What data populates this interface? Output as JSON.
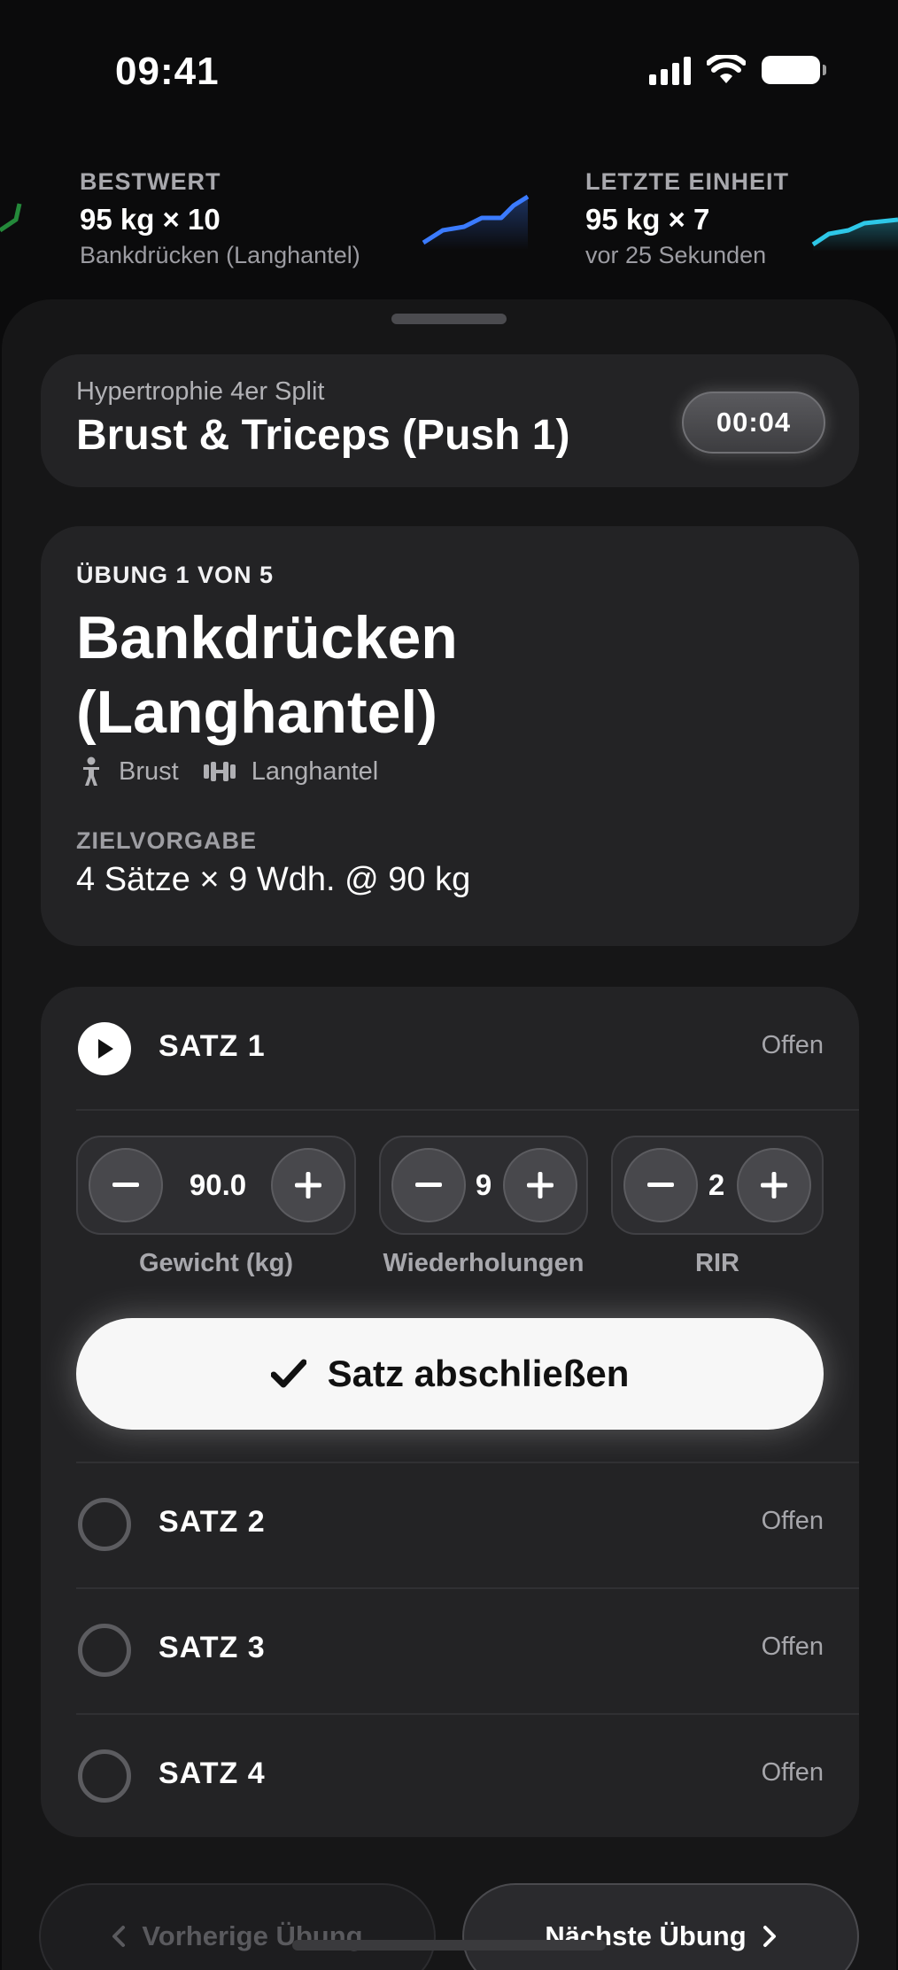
{
  "status_bar": {
    "time": "09:41"
  },
  "widgets": [
    {
      "label": "BESTWERT",
      "value": "95 kg × 10",
      "sub": "Bankdrücken (Langhantel)",
      "color": "#3b7bff"
    },
    {
      "label": "LETZTE EINHEIT",
      "value": "95 kg × 7",
      "sub": "vor 25 Sekunden",
      "color": "#2ec8e8"
    }
  ],
  "header": {
    "plan": "Hypertrophie 4er Split",
    "title": "Brust & Triceps (Push 1)",
    "timer": "00:04"
  },
  "exercise": {
    "counter": "ÜBUNG 1 VON 5",
    "name": "Bankdrücken (Langhantel)",
    "muscle": "Brust",
    "equipment": "Langhantel",
    "goal_label": "ZIELVORGABE",
    "goal": "4 Sätze × 9 Wdh. @ 90 kg"
  },
  "sets": {
    "active": {
      "label": "SATZ 1",
      "state": "Offen",
      "steppers": [
        {
          "value": "90.0",
          "label": "Gewicht (kg)"
        },
        {
          "value": "9",
          "label": "Wiederholungen"
        },
        {
          "value": "2",
          "label": "RIR"
        }
      ],
      "finish_label": "Satz abschließen"
    },
    "pending": [
      {
        "label": "SATZ 2",
        "state": "Offen"
      },
      {
        "label": "SATZ 3",
        "state": "Offen"
      },
      {
        "label": "SATZ 4",
        "state": "Offen"
      }
    ]
  },
  "nav": {
    "prev_label": "Vorherige Übung",
    "next_label": "Nächste Übung"
  }
}
